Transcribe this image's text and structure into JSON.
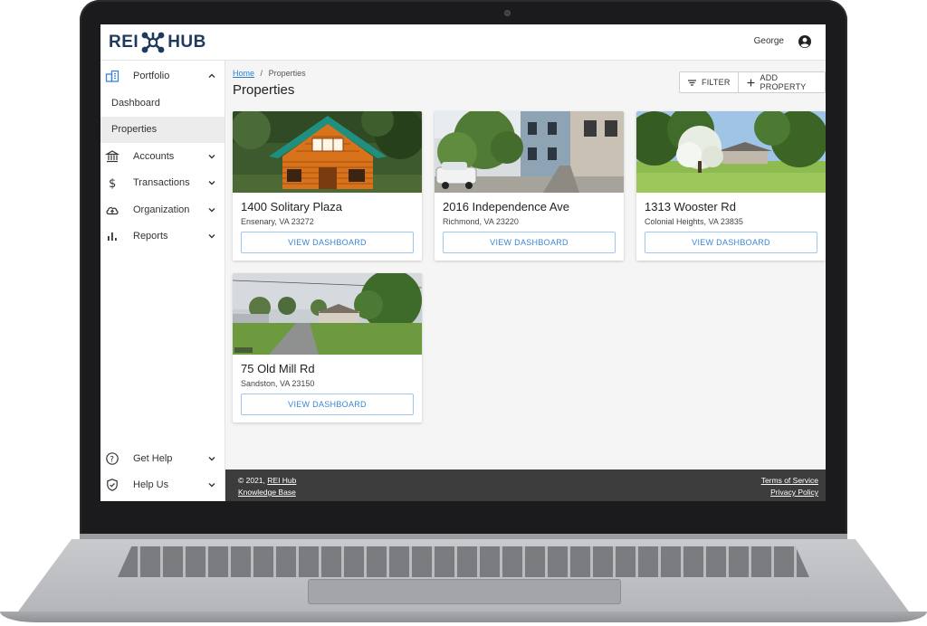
{
  "brand": {
    "logo_left": "REI",
    "logo_right": "HUB",
    "logo_color": "#1e3a5f"
  },
  "header": {
    "user_name": "George",
    "user_icon": "account-circle-icon"
  },
  "sidebar": {
    "items": [
      {
        "label": "Portfolio",
        "icon": "portfolio-icon",
        "expanded": true
      },
      {
        "label": "Accounts",
        "icon": "bank-icon"
      },
      {
        "label": "Transactions",
        "icon": "dollar-icon"
      },
      {
        "label": "Organization",
        "icon": "cloud-icon"
      },
      {
        "label": "Reports",
        "icon": "bar-chart-icon"
      }
    ],
    "portfolio_children": [
      "Dashboard",
      "Properties"
    ],
    "active_child": "Properties",
    "bottom_items": [
      {
        "label": "Get Help",
        "icon": "help-circle-icon"
      },
      {
        "label": "Help Us",
        "icon": "shield-check-icon"
      }
    ]
  },
  "breadcrumb": {
    "home": "Home",
    "separator": "/",
    "current": "Properties"
  },
  "page": {
    "title": "Properties"
  },
  "toolbar": {
    "filter_label": "FILTER",
    "add_label": "ADD PROPERTY"
  },
  "properties": [
    {
      "address": "1400 Solitary Plaza",
      "city": "Ensenary, VA 23272",
      "button": "VIEW DASHBOARD"
    },
    {
      "address": "2016 Independence Ave",
      "city": "Richmond, VA 23220",
      "button": "VIEW DASHBOARD"
    },
    {
      "address": "1313 Wooster Rd",
      "city": "Colonial Heights, VA 23835",
      "button": "VIEW DASHBOARD"
    },
    {
      "address": "75 Old Mill Rd",
      "city": "Sandston, VA 23150",
      "button": "VIEW DASHBOARD"
    }
  ],
  "footer": {
    "copyright_prefix": "© 2021, ",
    "copyright_link": "REI Hub",
    "knowledge_base": "Knowledge Base",
    "terms": "Terms of Service",
    "privacy": "Privacy Policy"
  },
  "colors": {
    "accent": "#2a7fd4",
    "button_border": "#9fc6ee",
    "footer_bg": "#3c3c3c",
    "active_bg": "#ececec"
  }
}
